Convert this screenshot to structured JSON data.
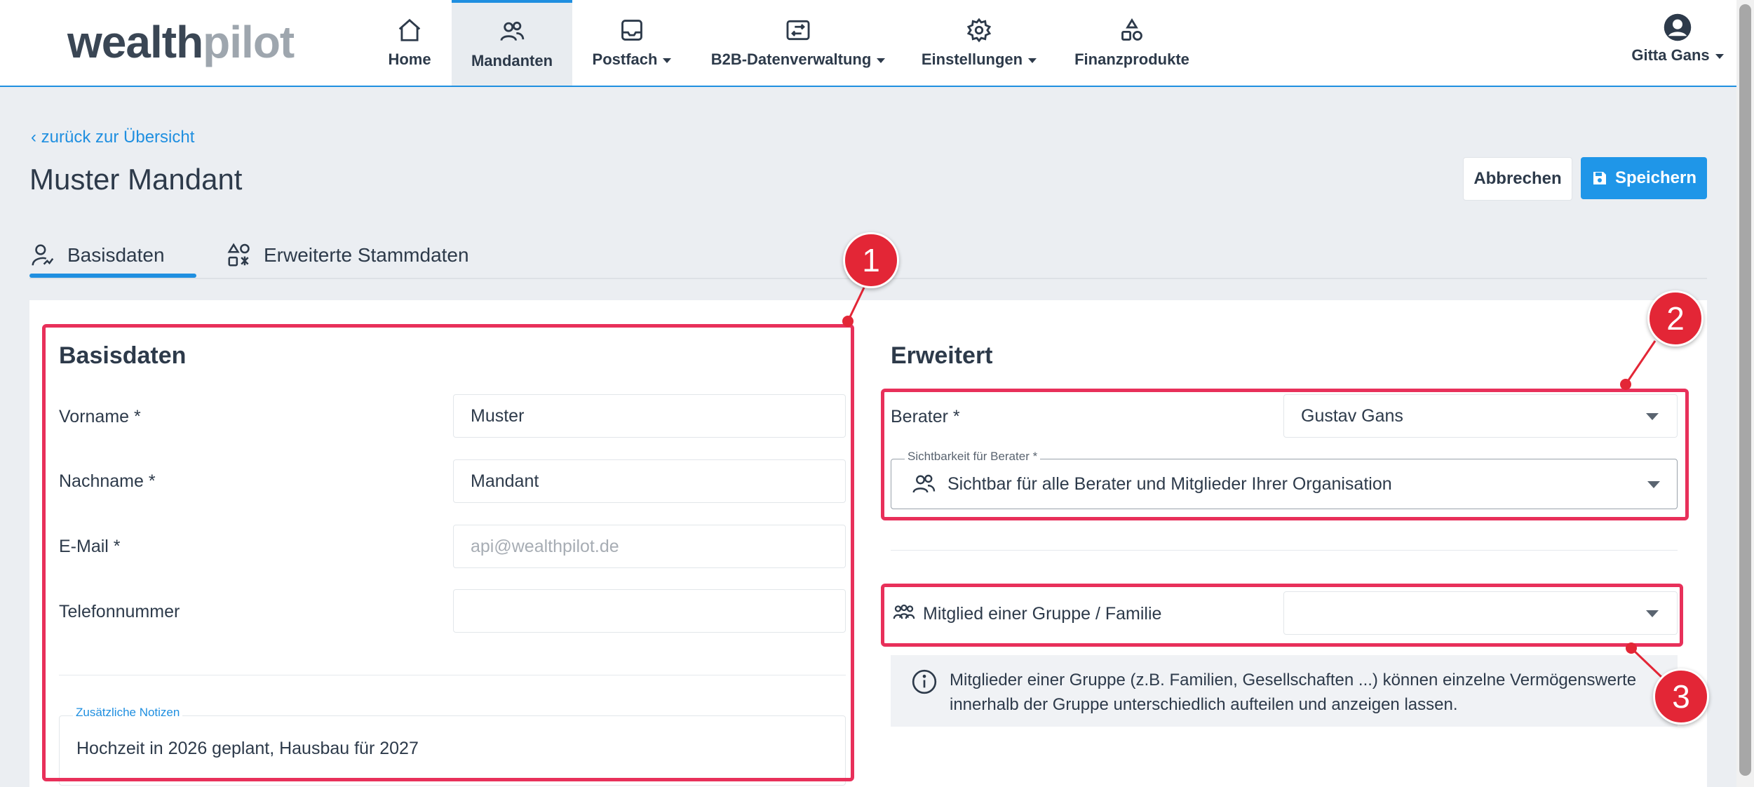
{
  "app": {
    "logo_main": "wealth",
    "logo_suffix": "pilot"
  },
  "nav": {
    "home": "Home",
    "mandanten": "Mandanten",
    "postfach": "Postfach",
    "b2b": "B2B-Datenverwaltung",
    "einstellungen": "Einstellungen",
    "finanzprodukte": "Finanzprodukte",
    "user": "Gitta Gans"
  },
  "page": {
    "back_link": "‹ zurück zur Übersicht",
    "title": "Muster Mandant",
    "cancel_label": "Abbrechen",
    "save_label": "Speichern"
  },
  "tabs": [
    {
      "label": "Basisdaten",
      "active": true
    },
    {
      "label": "Erweiterte Stammdaten",
      "active": false
    }
  ],
  "basisdaten": {
    "title": "Basisdaten",
    "vorname_label": "Vorname *",
    "vorname_value": "Muster",
    "nachname_label": "Nachname *",
    "nachname_value": "Mandant",
    "email_label": "E-Mail *",
    "email_placeholder": "api@wealthpilot.de",
    "telefon_label": "Telefonnummer",
    "telefon_value": "",
    "notizen_label": "Zusätzliche Notizen",
    "notizen_value": "Hochzeit in 2026 geplant, Hausbau für 2027"
  },
  "erweitert": {
    "title": "Erweitert",
    "berater_label": "Berater *",
    "berater_value": "Gustav Gans",
    "sichtbarkeit_label": "Sichtbarkeit für Berater *",
    "sichtbarkeit_value": "Sichtbar für alle Berater und Mitglieder Ihrer Organisation",
    "gruppe_label": "Mitglied einer Gruppe / Familie",
    "gruppe_value": "",
    "info_line1": "Mitglieder einer Gruppe (z.B. Familien, Gesellschaften ...) können einzelne Vermögenswerte",
    "info_line2": "innerhalb der Gruppe unterschiedlich aufteilen und anzeigen lassen."
  },
  "annotations": [
    "1",
    "2",
    "3"
  ],
  "colors": {
    "accent": "#1f8fe0",
    "annotation": "#e8305a",
    "badge": "#e32636"
  }
}
